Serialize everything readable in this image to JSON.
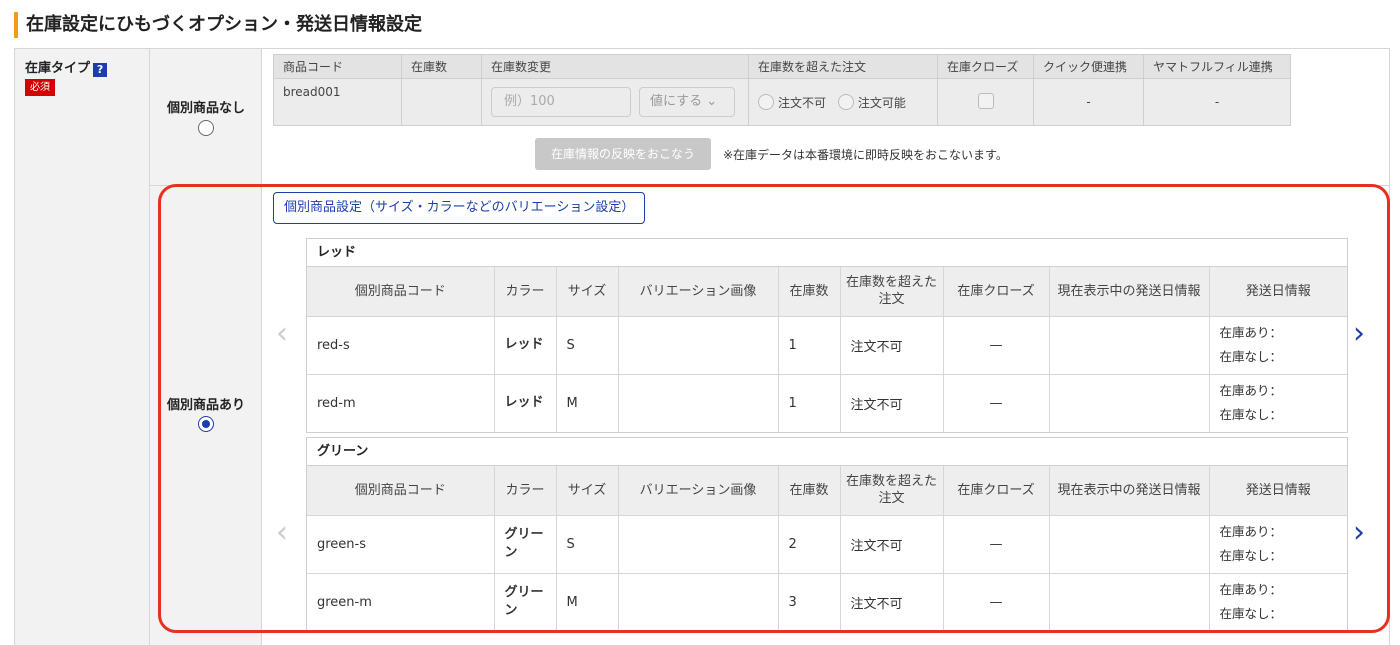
{
  "page": {
    "title": "在庫設定にひもづくオプション・発送日情報設定"
  },
  "field": {
    "label": "在庫タイプ",
    "help_icon": "?",
    "required_badge": "必須"
  },
  "options": [
    {
      "label": "個別商品なし",
      "selected": false
    },
    {
      "label": "個別商品あり",
      "selected": true
    }
  ],
  "simple_stock": {
    "headers": [
      "商品コード",
      "在庫数",
      "在庫数変更",
      "在庫数を超えた注文",
      "在庫クローズ",
      "クイック便連携",
      "ヤマトフルフィル連携"
    ],
    "row": {
      "code": "bread001",
      "stock": "",
      "change_placeholder": "例）100",
      "change_select": "値にする",
      "chevron_icon": "chevron-down",
      "order_not_allowed": "注文不可",
      "order_allowed": "注文可能",
      "quick": "-",
      "yamato": "-"
    },
    "reflect_button": "在庫情報の反映をおこなう",
    "reflect_note": "※在庫データは本番環境に即時反映をおこないます。"
  },
  "variations": {
    "settings_button": "個別商品設定（サイズ・カラーなどのバリエーション設定）",
    "headers": [
      "個別商品コード",
      "カラー",
      "サイズ",
      "バリエーション画像",
      "在庫数",
      "在庫数を超えた注文",
      "在庫クローズ",
      "現在表示中の発送日情報",
      "発送日情報"
    ],
    "ship_in_stock": "在庫あり：",
    "ship_out_of_stock": "在庫なし：",
    "arrow_left": "‹",
    "arrow_right": "›",
    "groups": [
      {
        "title": "レッド",
        "rows": [
          {
            "code": "red-s",
            "color": "レッド",
            "size": "S",
            "image": "",
            "stock": "1",
            "over_order": "注文不可",
            "close": "—",
            "current_ship": ""
          },
          {
            "code": "red-m",
            "color": "レッド",
            "size": "M",
            "image": "",
            "stock": "1",
            "over_order": "注文不可",
            "close": "—",
            "current_ship": ""
          }
        ]
      },
      {
        "title": "グリーン",
        "rows": [
          {
            "code": "green-s",
            "color": "グリーン",
            "size": "S",
            "image": "",
            "stock": "2",
            "over_order": "注文不可",
            "close": "—",
            "current_ship": ""
          },
          {
            "code": "green-m",
            "color": "グリーン",
            "size": "M",
            "image": "",
            "stock": "3",
            "over_order": "注文不可",
            "close": "—",
            "current_ship": ""
          }
        ]
      }
    ]
  },
  "colors": {
    "accent_bar": "#f29b16",
    "link_blue": "#1a3faa",
    "required_red": "#d40000",
    "highlight_red": "#e8301f"
  }
}
